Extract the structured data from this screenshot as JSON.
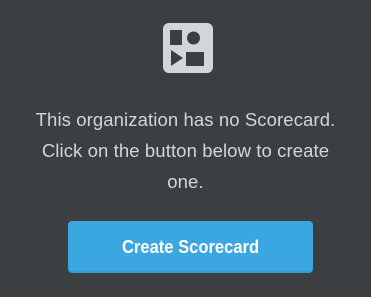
{
  "empty_state": {
    "icon": "scorecard-icon",
    "message_lines": [
      "This organization has no Scorecard.",
      "Click on the button below to create",
      "one."
    ],
    "button_label": "Create Scorecard"
  },
  "colors": {
    "panel_background": "#3b3f42",
    "text": "#d3d6d8",
    "button_background": "#3ba7e0",
    "button_text": "#ffffff",
    "icon": "#d3d6d8"
  }
}
